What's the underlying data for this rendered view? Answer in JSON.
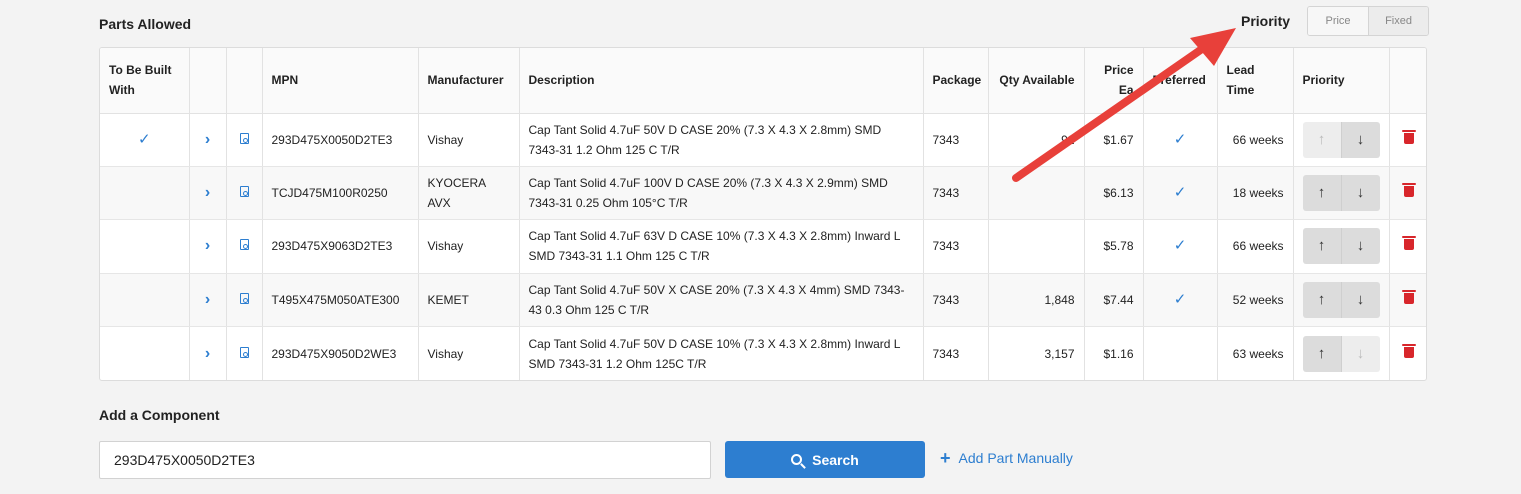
{
  "parts_section": {
    "title": "Parts Allowed"
  },
  "priority_toggle": {
    "label": "Priority",
    "options": [
      "Price",
      "Fixed"
    ]
  },
  "table": {
    "headers": {
      "to_be_built_with": "To Be Built With",
      "mpn": "MPN",
      "manufacturer": "Manufacturer",
      "description": "Description",
      "package": "Package",
      "qty_available": "Qty Available",
      "price_each": "Price Ea",
      "preferred": "Preferred",
      "lead_time": "Lead Time",
      "priority": "Priority"
    },
    "rows": [
      {
        "mpn": "293D475X0050D2TE3",
        "manufacturer": "Vishay",
        "description": "Cap Tant Solid 4.7uF 50V D CASE 20% (7.3 X 4.3 X 2.8mm) SMD 7343-31 1.2 Ohm 125 C T/R",
        "package": "7343",
        "qty": "92",
        "price": "$1.67",
        "lead_time": "66 weeks",
        "to_be_built_with": true,
        "preferred": true,
        "up_enabled": false,
        "down_enabled": true
      },
      {
        "mpn": "TCJD475M100R0250",
        "manufacturer": "KYOCERA AVX",
        "description": "Cap Tant Solid 4.7uF 100V D CASE 20% (7.3 X 4.3 X 2.9mm) SMD 7343-31 0.25 Ohm 105°C T/R",
        "package": "7343",
        "qty": "",
        "price": "$6.13",
        "lead_time": "18 weeks",
        "to_be_built_with": false,
        "preferred": true,
        "up_enabled": true,
        "down_enabled": true
      },
      {
        "mpn": "293D475X9063D2TE3",
        "manufacturer": "Vishay",
        "description": "Cap Tant Solid 4.7uF 63V D CASE 10% (7.3 X 4.3 X 2.8mm) Inward L SMD 7343-31 1.1 Ohm 125 C T/R",
        "package": "7343",
        "qty": "",
        "price": "$5.78",
        "lead_time": "66 weeks",
        "to_be_built_with": false,
        "preferred": true,
        "up_enabled": true,
        "down_enabled": true
      },
      {
        "mpn": "T495X475M050ATE300",
        "manufacturer": "KEMET",
        "description": "Cap Tant Solid 4.7uF 50V X CASE 20% (7.3 X 4.3 X 4mm) SMD 7343-43 0.3 Ohm 125 C T/R",
        "package": "7343",
        "qty": "1,848",
        "price": "$7.44",
        "lead_time": "52 weeks",
        "to_be_built_with": false,
        "preferred": true,
        "up_enabled": true,
        "down_enabled": true
      },
      {
        "mpn": "293D475X9050D2WE3",
        "manufacturer": "Vishay",
        "description": "Cap Tant Solid 4.7uF 50V D CASE 10% (7.3 X 4.3 X 2.8mm) Inward L SMD 7343-31 1.2 Ohm 125C T/R",
        "package": "7343",
        "qty": "3,157",
        "price": "$1.16",
        "lead_time": "63 weeks",
        "to_be_built_with": false,
        "preferred": false,
        "up_enabled": true,
        "down_enabled": false
      }
    ]
  },
  "add_component": {
    "title": "Add a Component",
    "input_value": "293D475X0050D2TE3",
    "search_label": "Search",
    "add_manual_label": "Add Part Manually"
  },
  "colors": {
    "accent": "#2d7ed0",
    "danger": "#d8262b",
    "annotation_arrow": "#e8403a"
  },
  "icons": [
    "check-icon",
    "chevron-right-icon",
    "pdf-icon",
    "arrow-up-icon",
    "arrow-down-icon",
    "trash-icon",
    "search-icon",
    "plus-icon"
  ]
}
